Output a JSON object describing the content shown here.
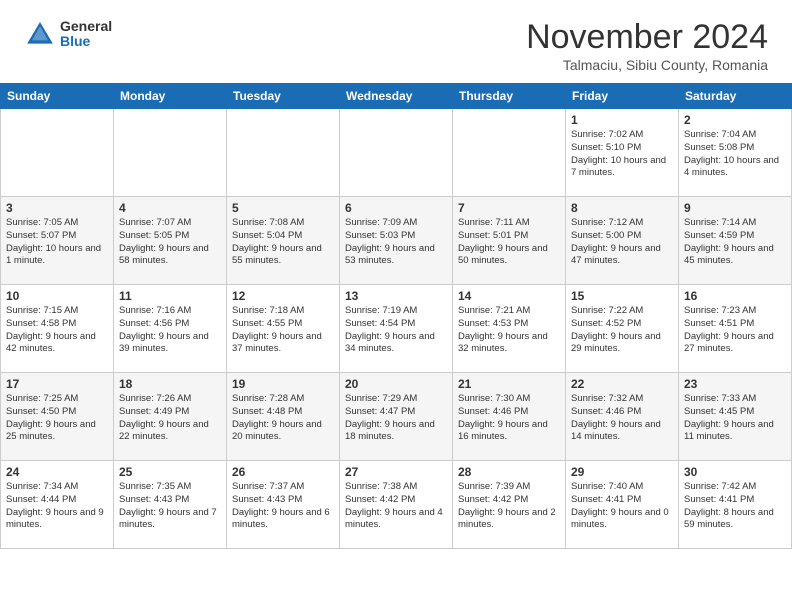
{
  "header": {
    "logo_general": "General",
    "logo_blue": "Blue",
    "month_title": "November 2024",
    "subtitle": "Talmaciu, Sibiu County, Romania"
  },
  "weekdays": [
    "Sunday",
    "Monday",
    "Tuesday",
    "Wednesday",
    "Thursday",
    "Friday",
    "Saturday"
  ],
  "weeks": [
    [
      {
        "day": "",
        "info": ""
      },
      {
        "day": "",
        "info": ""
      },
      {
        "day": "",
        "info": ""
      },
      {
        "day": "",
        "info": ""
      },
      {
        "day": "",
        "info": ""
      },
      {
        "day": "1",
        "info": "Sunrise: 7:02 AM\nSunset: 5:10 PM\nDaylight: 10 hours\nand 7 minutes."
      },
      {
        "day": "2",
        "info": "Sunrise: 7:04 AM\nSunset: 5:08 PM\nDaylight: 10 hours\nand 4 minutes."
      }
    ],
    [
      {
        "day": "3",
        "info": "Sunrise: 7:05 AM\nSunset: 5:07 PM\nDaylight: 10 hours\nand 1 minute."
      },
      {
        "day": "4",
        "info": "Sunrise: 7:07 AM\nSunset: 5:05 PM\nDaylight: 9 hours\nand 58 minutes."
      },
      {
        "day": "5",
        "info": "Sunrise: 7:08 AM\nSunset: 5:04 PM\nDaylight: 9 hours\nand 55 minutes."
      },
      {
        "day": "6",
        "info": "Sunrise: 7:09 AM\nSunset: 5:03 PM\nDaylight: 9 hours\nand 53 minutes."
      },
      {
        "day": "7",
        "info": "Sunrise: 7:11 AM\nSunset: 5:01 PM\nDaylight: 9 hours\nand 50 minutes."
      },
      {
        "day": "8",
        "info": "Sunrise: 7:12 AM\nSunset: 5:00 PM\nDaylight: 9 hours\nand 47 minutes."
      },
      {
        "day": "9",
        "info": "Sunrise: 7:14 AM\nSunset: 4:59 PM\nDaylight: 9 hours\nand 45 minutes."
      }
    ],
    [
      {
        "day": "10",
        "info": "Sunrise: 7:15 AM\nSunset: 4:58 PM\nDaylight: 9 hours\nand 42 minutes."
      },
      {
        "day": "11",
        "info": "Sunrise: 7:16 AM\nSunset: 4:56 PM\nDaylight: 9 hours\nand 39 minutes."
      },
      {
        "day": "12",
        "info": "Sunrise: 7:18 AM\nSunset: 4:55 PM\nDaylight: 9 hours\nand 37 minutes."
      },
      {
        "day": "13",
        "info": "Sunrise: 7:19 AM\nSunset: 4:54 PM\nDaylight: 9 hours\nand 34 minutes."
      },
      {
        "day": "14",
        "info": "Sunrise: 7:21 AM\nSunset: 4:53 PM\nDaylight: 9 hours\nand 32 minutes."
      },
      {
        "day": "15",
        "info": "Sunrise: 7:22 AM\nSunset: 4:52 PM\nDaylight: 9 hours\nand 29 minutes."
      },
      {
        "day": "16",
        "info": "Sunrise: 7:23 AM\nSunset: 4:51 PM\nDaylight: 9 hours\nand 27 minutes."
      }
    ],
    [
      {
        "day": "17",
        "info": "Sunrise: 7:25 AM\nSunset: 4:50 PM\nDaylight: 9 hours\nand 25 minutes."
      },
      {
        "day": "18",
        "info": "Sunrise: 7:26 AM\nSunset: 4:49 PM\nDaylight: 9 hours\nand 22 minutes."
      },
      {
        "day": "19",
        "info": "Sunrise: 7:28 AM\nSunset: 4:48 PM\nDaylight: 9 hours\nand 20 minutes."
      },
      {
        "day": "20",
        "info": "Sunrise: 7:29 AM\nSunset: 4:47 PM\nDaylight: 9 hours\nand 18 minutes."
      },
      {
        "day": "21",
        "info": "Sunrise: 7:30 AM\nSunset: 4:46 PM\nDaylight: 9 hours\nand 16 minutes."
      },
      {
        "day": "22",
        "info": "Sunrise: 7:32 AM\nSunset: 4:46 PM\nDaylight: 9 hours\nand 14 minutes."
      },
      {
        "day": "23",
        "info": "Sunrise: 7:33 AM\nSunset: 4:45 PM\nDaylight: 9 hours\nand 11 minutes."
      }
    ],
    [
      {
        "day": "24",
        "info": "Sunrise: 7:34 AM\nSunset: 4:44 PM\nDaylight: 9 hours\nand 9 minutes."
      },
      {
        "day": "25",
        "info": "Sunrise: 7:35 AM\nSunset: 4:43 PM\nDaylight: 9 hours\nand 7 minutes."
      },
      {
        "day": "26",
        "info": "Sunrise: 7:37 AM\nSunset: 4:43 PM\nDaylight: 9 hours\nand 6 minutes."
      },
      {
        "day": "27",
        "info": "Sunrise: 7:38 AM\nSunset: 4:42 PM\nDaylight: 9 hours\nand 4 minutes."
      },
      {
        "day": "28",
        "info": "Sunrise: 7:39 AM\nSunset: 4:42 PM\nDaylight: 9 hours\nand 2 minutes."
      },
      {
        "day": "29",
        "info": "Sunrise: 7:40 AM\nSunset: 4:41 PM\nDaylight: 9 hours\nand 0 minutes."
      },
      {
        "day": "30",
        "info": "Sunrise: 7:42 AM\nSunset: 4:41 PM\nDaylight: 8 hours\nand 59 minutes."
      }
    ]
  ]
}
